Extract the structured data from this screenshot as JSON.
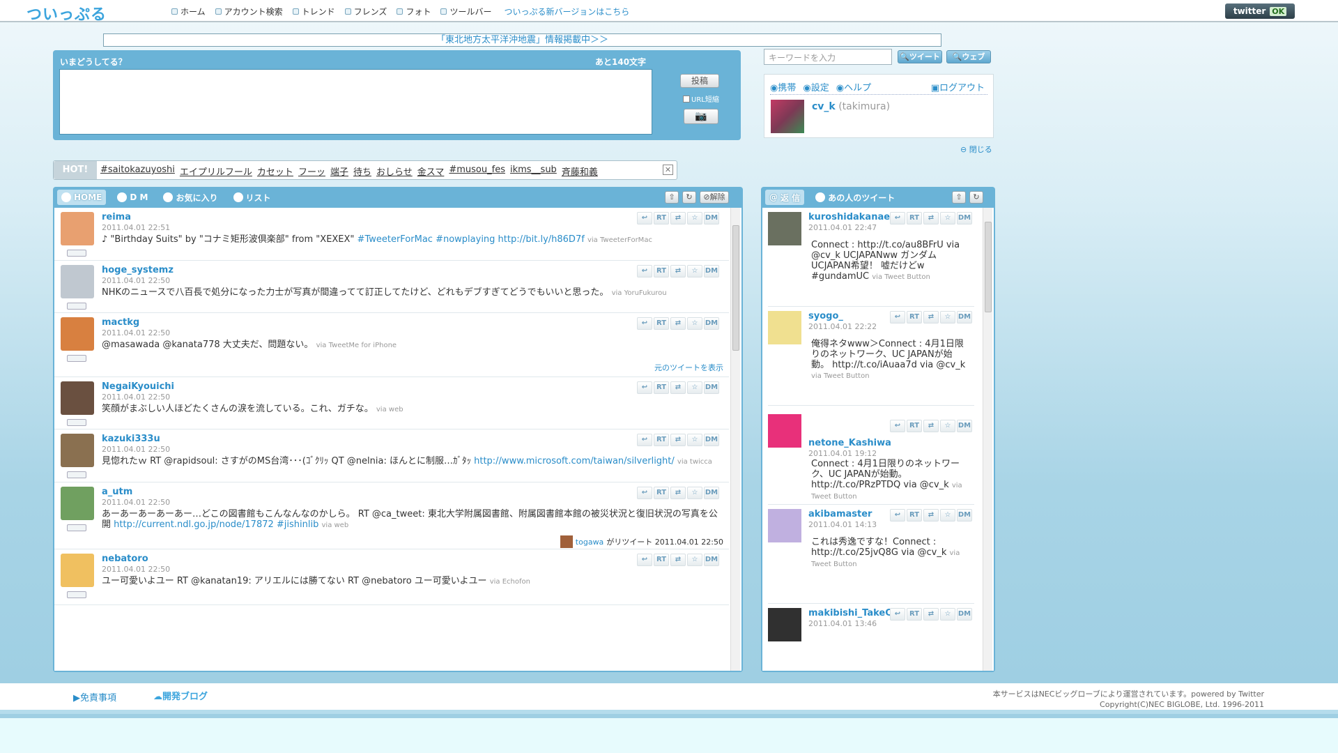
{
  "app": {
    "logo": "ついっぷる"
  },
  "topnav": {
    "items": [
      "ホーム",
      "アカウント検索",
      "トレンド",
      "フレンズ",
      "フォト",
      "ツールバー"
    ],
    "new_version": "ついっぷる新バージョンはこちら",
    "twitter_status": "twitter",
    "twitter_ok": "OK"
  },
  "banner": "「東北地方太平洋沖地震」情報掲載中＞＞",
  "post": {
    "label": "いまどうしてる？",
    "counter": "あと140文字",
    "submit": "投稿",
    "url_shorten": "URL短縮"
  },
  "search": {
    "placeholder": "キーワードを入力",
    "tweet_btn": "ツイート",
    "web_btn": "ウェブ"
  },
  "user": {
    "links": [
      "携帯",
      "設定",
      "ヘルプ"
    ],
    "logout": "ログアウト",
    "screen_name": "cv_k",
    "name": "(takimura)",
    "close": "閉じる"
  },
  "hot": {
    "label": "HOT!",
    "tags": [
      "#saitokazuyoshi",
      "エイプリルフール",
      "カセット",
      "フーッ",
      "端子",
      "待ち",
      "おしらせ",
      "金スマ",
      "#musou_fes",
      "ikms__sub",
      "斉藤和義"
    ]
  },
  "main_tabs": {
    "home": "HOME",
    "dm": "D M",
    "fav": "お気に入り",
    "list": "リスト",
    "clear": "解除"
  },
  "side_tabs": {
    "reply": "返 信",
    "that": "あの人のツイート"
  },
  "action_labels": {
    "rt": "RT",
    "dm": "DM"
  },
  "timeline": [
    {
      "user": "reima",
      "date": "2011.04.01 22:51",
      "text": "♪ \"Birthday Suits\" by \"コナミ矩形波倶楽部\" from \"XEXEX\" ",
      "links": "#TweeterForMac #nowplaying http://bit.ly/h86D7f",
      "via": "via TweeterForMac"
    },
    {
      "user": "hoge_systemz",
      "date": "2011.04.01 22:50",
      "text": "NHKのニュースで八百長で処分になった力士が写真が間違ってて訂正してたけど、どれもデブすぎてどうでもいいと思った。",
      "links": "",
      "via": "via YoruFukurou"
    },
    {
      "user": "mactkg",
      "date": "2011.04.01 22:50",
      "text": "@masawada @kanata778 大丈夫だ、問題ない。",
      "links": "",
      "via": "via TweetMe for iPhone",
      "show_orig": "元のツイートを表示"
    },
    {
      "user": "NegaiKyouichi",
      "date": "2011.04.01 22:50",
      "text": "笑顔がまぶしい人ほどたくさんの涙を流している。これ、ガチな。",
      "links": "",
      "via": "via web"
    },
    {
      "user": "kazuki333u",
      "date": "2011.04.01 22:50",
      "text": "見惚れたｗ RT @rapidsoul: さすがのMS台湾･･･(ｺﾞｸﾘｯ QT @nelnia: ほんとに制服…ｶﾞﾀｯ ",
      "links": "http://www.microsoft.com/taiwan/silverlight/",
      "via": "via twicca"
    },
    {
      "user": "a_utm",
      "date": "2011.04.01 22:50",
      "text": "あーあーあーあーあー…どこの図書館もこんなんなのかしら。 RT @ca_tweet: 東北大学附属図書館、附属図書館本館の被災状況と復旧状況の写真を公開 ",
      "links": "http://current.ndl.go.jp/node/17872 #jishinlib",
      "via": "via web",
      "rt_by": "togawa",
      "rt_text": "がリツイート 2011.04.01 22:50"
    },
    {
      "user": "nebatoro",
      "date": "2011.04.01 22:50",
      "text": "ユー可愛いよユー RT @kanatan19: アリエルには勝てない RT @nebatoro ユー可愛いよユー",
      "links": "",
      "via": "via Echofon"
    }
  ],
  "replies": [
    {
      "user": "kuroshidakanae",
      "date": "2011.04.01 22:47",
      "text": "Connect : http://t.co/au8BFrU via @cv_k UCJAPANww ガンダムUCJAPAN希望！ 嘘だけどw #gundamUC",
      "via": "via Tweet Button"
    },
    {
      "user": "syogo_",
      "date": "2011.04.01 22:22",
      "text": "俺得ネタwww＞Connect : 4月1日限りのネットワーク、UC JAPANが始動。 http://t.co/iAuaa7d via @cv_k",
      "via": "via Tweet Button"
    },
    {
      "user": "netone_Kashiwa",
      "date": "2011.04.01 19:12",
      "text": "Connect : 4月1日限りのネットワーク、UC JAPANが始動。 http://t.co/PRzPTDQ via @cv_k",
      "via": "via Tweet Button"
    },
    {
      "user": "akibamaster",
      "date": "2011.04.01 14:13",
      "text": "これは秀逸ですな！Connect : http://t.co/25jvQ8G via @cv_k",
      "via": "via Tweet Button"
    },
    {
      "user": "makibishi_TakeC",
      "date": "2011.04.01 13:46",
      "text": "",
      "via": ""
    }
  ],
  "footer": {
    "disclaimer": "免責事項",
    "blog": "開発ブログ",
    "operated": "本サービスはNECビッグローブにより運営されています。powered by Twitter",
    "copyright": "Copyright(C)NEC BIGLOBE, Ltd. 1996-2011"
  }
}
